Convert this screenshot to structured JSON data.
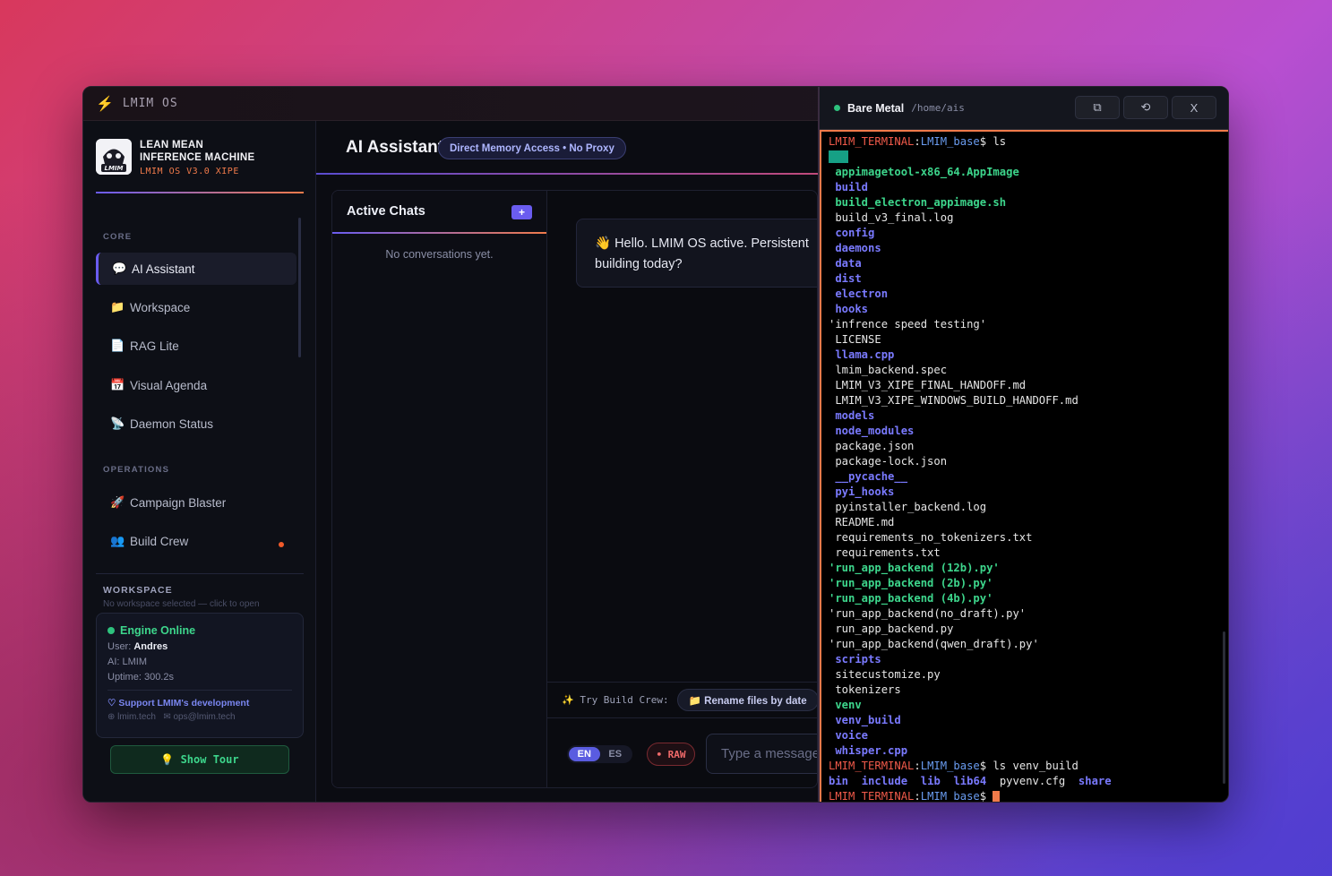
{
  "window": {
    "title": "LMIM OS"
  },
  "brand": {
    "line1": "LEAN MEAN",
    "line2": "INFERENCE MACHINE",
    "sub": "LMIM OS V3.0 XIPE",
    "logo_text": "LMIM"
  },
  "sidebar": {
    "core_label": "CORE",
    "operations_label": "OPERATIONS",
    "items": [
      {
        "label": "AI Assistant",
        "icon": "💬"
      },
      {
        "label": "Workspace",
        "icon": "📁"
      },
      {
        "label": "RAG Lite",
        "icon": "📄"
      },
      {
        "label": "Visual Agenda",
        "icon": "📅"
      },
      {
        "label": "Daemon Status",
        "icon": "📡"
      },
      {
        "label": "Campaign Blaster",
        "icon": "🚀"
      },
      {
        "label": "Build Crew",
        "icon": "👥"
      }
    ],
    "workspace_label": "WORKSPACE",
    "workspace_sub": "No workspace selected — click to open",
    "status": {
      "engine": "Engine Online",
      "user_key": "User:",
      "user_val": "Andres",
      "ai": "AI: LMIM",
      "uptime": "Uptime: 300.2s",
      "support": "♡ Support LMIM's development",
      "site": "lmim.tech",
      "email": "ops@lmim.tech"
    },
    "tour_button": "💡 Show Tour"
  },
  "main": {
    "title": "AI Assistant",
    "pill": "Direct Memory Access • No Proxy",
    "chats_title": "Active Chats",
    "add_label": "+",
    "no_conversations": "No conversations yet.",
    "greeting_line1": "👋 Hello. LMIM OS active. Persistent",
    "greeting_line2": "building today?",
    "try_label": "✨ Try Build Crew:",
    "chip": "📁 Rename files by date",
    "lang_en": "EN",
    "lang_es": "ES",
    "raw": "• RAW",
    "input_placeholder": "Type a message"
  },
  "terminal": {
    "name": "Bare Metal",
    "path": "/home/ais",
    "btn_copy": "⧉",
    "btn_reset": "⟲",
    "btn_close": "X",
    "prompt_user": "LMIM_TERMINAL",
    "prompt_path": "LMIM_base",
    "cmd1": "ls",
    "cmd2": "ls venv_build",
    "entries": [
      {
        "name": "   ",
        "kind": "hl"
      },
      {
        "name": " appimagetool-x86_64.AppImage",
        "kind": "exe"
      },
      {
        "name": " build",
        "kind": "dir"
      },
      {
        "name": " build_electron_appimage.sh",
        "kind": "exe"
      },
      {
        "name": " build_v3_final.log",
        "kind": "file"
      },
      {
        "name": " config",
        "kind": "dir"
      },
      {
        "name": " daemons",
        "kind": "dir"
      },
      {
        "name": " data",
        "kind": "dir"
      },
      {
        "name": " dist",
        "kind": "dir"
      },
      {
        "name": " electron",
        "kind": "dir"
      },
      {
        "name": " hooks",
        "kind": "dir"
      },
      {
        "name": "'infrence speed testing'",
        "kind": "file"
      },
      {
        "name": " LICENSE",
        "kind": "file"
      },
      {
        "name": " llama.cpp",
        "kind": "dir"
      },
      {
        "name": " lmim_backend.spec",
        "kind": "file"
      },
      {
        "name": " LMIM_V3_XIPE_FINAL_HANDOFF.md",
        "kind": "file"
      },
      {
        "name": " LMIM_V3_XIPE_WINDOWS_BUILD_HANDOFF.md",
        "kind": "file"
      },
      {
        "name": " models",
        "kind": "dir"
      },
      {
        "name": " node_modules",
        "kind": "dir"
      },
      {
        "name": " package.json",
        "kind": "file"
      },
      {
        "name": " package-lock.json",
        "kind": "file"
      },
      {
        "name": " __pycache__",
        "kind": "dir"
      },
      {
        "name": " pyi_hooks",
        "kind": "dir"
      },
      {
        "name": " pyinstaller_backend.log",
        "kind": "file"
      },
      {
        "name": " README.md",
        "kind": "file"
      },
      {
        "name": " requirements_no_tokenizers.txt",
        "kind": "file"
      },
      {
        "name": " requirements.txt",
        "kind": "file"
      },
      {
        "name": "'run_app_backend (12b).py'",
        "kind": "exe"
      },
      {
        "name": "'run_app_backend (2b).py'",
        "kind": "exe"
      },
      {
        "name": "'run_app_backend (4b).py'",
        "kind": "exe"
      },
      {
        "name": "'run_app_backend(no_draft).py'",
        "kind": "file"
      },
      {
        "name": " run_app_backend.py",
        "kind": "file"
      },
      {
        "name": "'run_app_backend(qwen_draft).py'",
        "kind": "file"
      },
      {
        "name": " scripts",
        "kind": "dir"
      },
      {
        "name": " sitecustomize.py",
        "kind": "file"
      },
      {
        "name": " tokenizers",
        "kind": "file"
      },
      {
        "name": " venv",
        "kind": "exe"
      },
      {
        "name": " venv_build",
        "kind": "dir"
      },
      {
        "name": " voice",
        "kind": "dir"
      },
      {
        "name": " whisper.cpp",
        "kind": "dir"
      }
    ],
    "venv_entries": [
      {
        "name": "bin",
        "kind": "dir"
      },
      {
        "name": "include",
        "kind": "dir"
      },
      {
        "name": "lib",
        "kind": "dir"
      },
      {
        "name": "lib64",
        "kind": "dir"
      },
      {
        "name": "pyvenv.cfg",
        "kind": "file"
      },
      {
        "name": "share",
        "kind": "dir"
      }
    ]
  }
}
